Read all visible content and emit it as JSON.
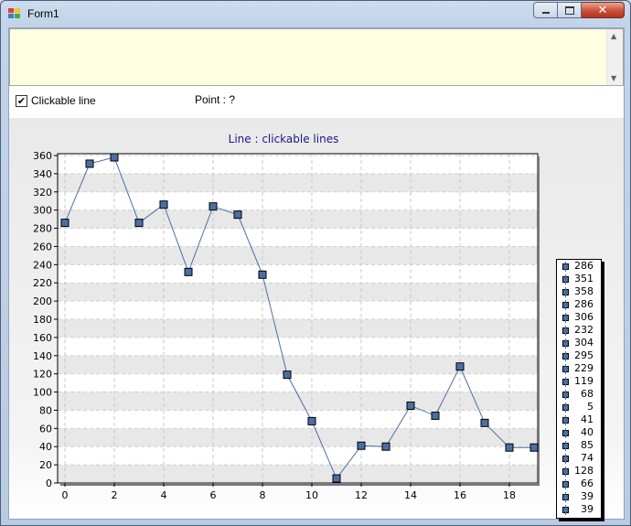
{
  "window": {
    "title": "Form1",
    "icon": "form-icon"
  },
  "caption": {
    "minimize_icon": "minimize-icon",
    "maximize_icon": "maximize-icon",
    "close_icon": "close-icon"
  },
  "controls": {
    "checkbox_label": "Clickable line",
    "checkbox_checked": true,
    "point_label": "Point : ?"
  },
  "colors": {
    "series": "#4b6fa5",
    "title": "#1a1a80",
    "textbox_bg": "#ffffe1"
  },
  "chart_data": {
    "type": "line",
    "title": "Line : clickable lines",
    "xlabel": "",
    "ylabel": "",
    "x": [
      0,
      1,
      2,
      3,
      4,
      5,
      6,
      7,
      8,
      9,
      10,
      11,
      12,
      13,
      14,
      15,
      16,
      17,
      18,
      19
    ],
    "values": [
      286,
      351,
      358,
      286,
      306,
      232,
      304,
      295,
      229,
      119,
      68,
      5,
      41,
      40,
      85,
      74,
      128,
      66,
      39,
      39
    ],
    "xlim": [
      0,
      19
    ],
    "ylim": [
      0,
      360
    ],
    "xticks": [
      "0",
      "2",
      "4",
      "6",
      "8",
      "10",
      "12",
      "14",
      "16",
      "18"
    ],
    "yticks": [
      "0",
      "20",
      "40",
      "60",
      "80",
      "100",
      "120",
      "140",
      "160",
      "180",
      "200",
      "220",
      "240",
      "260",
      "280",
      "300",
      "320",
      "340",
      "360"
    ],
    "grid": true,
    "legend": {
      "placement": "right",
      "items": [
        "286",
        "351",
        "358",
        "286",
        "306",
        "232",
        "304",
        "295",
        "229",
        "119",
        "68",
        "5",
        "41",
        "40",
        "85",
        "74",
        "128",
        "66",
        "39",
        "39"
      ]
    }
  }
}
